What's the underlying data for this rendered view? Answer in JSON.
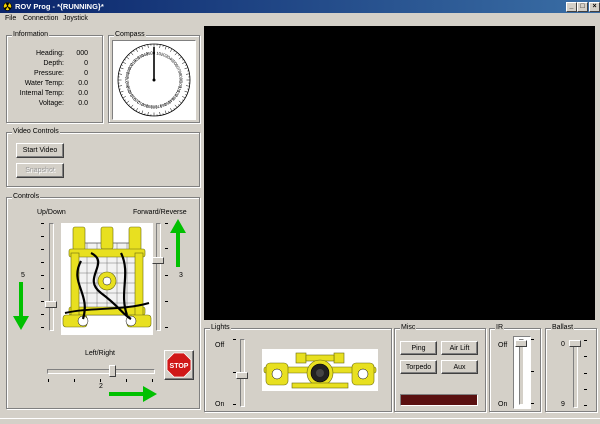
{
  "window": {
    "title": "ROV Prog - *{RUNNING}*",
    "min": "_",
    "max": "□",
    "close": "×"
  },
  "menu": [
    "File",
    "Connection",
    "Joystick"
  ],
  "information": {
    "legend": "Information",
    "rows": [
      {
        "label": "Heading:",
        "value": "000"
      },
      {
        "label": "Depth:",
        "value": "0"
      },
      {
        "label": "Pressure:",
        "value": "0"
      },
      {
        "label": "Water Temp:",
        "value": "0.0"
      },
      {
        "label": "Internal Temp:",
        "value": "0.0"
      },
      {
        "label": "Voltage:",
        "value": "0.0"
      }
    ]
  },
  "compass": {
    "legend": "Compass",
    "heading": 0,
    "labels": [
      "350",
      "340",
      "330",
      "320",
      "310",
      "300",
      "290",
      "280",
      "270",
      "260",
      "250",
      "240",
      "230",
      "220",
      "210",
      "200",
      "190",
      "180",
      "170",
      "160",
      "150",
      "140",
      "130",
      "120",
      "110",
      "100",
      "90",
      "80",
      "70",
      "60",
      "50",
      "40",
      "30",
      "20",
      "10",
      "0"
    ]
  },
  "video_controls": {
    "legend": "Video Controls",
    "start": "Start Video",
    "snapshot": "Snapshot"
  },
  "controls": {
    "legend": "Controls",
    "updown_label": "Up/Down",
    "updown_value": "5",
    "fwdrev_label": "Forward/Reverse",
    "fwdrev_value": "3",
    "leftright_label": "Left/Right",
    "leftright_value": "2",
    "stop": "STOP"
  },
  "lights": {
    "legend": "Lights",
    "off": "Off",
    "on": "On"
  },
  "misc": {
    "legend": "Misc",
    "ping": "Ping",
    "air_lift": "Air Lift",
    "torpedo": "Torpedo",
    "aux": "Aux"
  },
  "ir": {
    "legend": "IR",
    "off": "Off",
    "on": "On"
  },
  "ballast": {
    "legend": "Ballast",
    "top": "0",
    "bottom": "9"
  },
  "colors": {
    "accent": "#0a246a",
    "arrow": "#00c000",
    "stop": "#d01818",
    "rov": "#e8e020"
  }
}
